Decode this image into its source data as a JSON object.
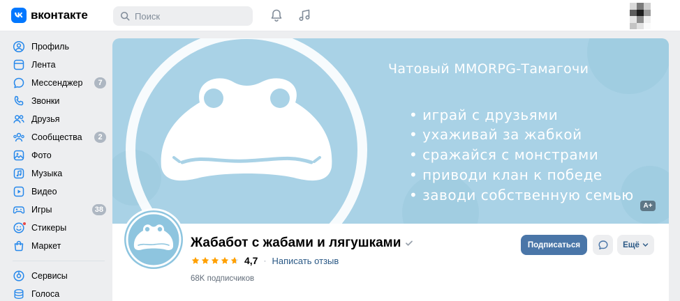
{
  "header": {
    "logo_text": "вконтакте",
    "logo_mark": "vk",
    "search_placeholder": "Поиск",
    "icons": [
      "bell-icon",
      "music-icon"
    ]
  },
  "sidebar": {
    "items": [
      {
        "label": "Профиль",
        "icon": "profile-icon"
      },
      {
        "label": "Лента",
        "icon": "feed-icon"
      },
      {
        "label": "Мессенджер",
        "icon": "messenger-icon",
        "badge": "7"
      },
      {
        "label": "Звонки",
        "icon": "phone-icon"
      },
      {
        "label": "Друзья",
        "icon": "friends-icon"
      },
      {
        "label": "Сообщества",
        "icon": "communities-icon",
        "badge": "2"
      },
      {
        "label": "Фото",
        "icon": "photo-icon"
      },
      {
        "label": "Музыка",
        "icon": "music-icon"
      },
      {
        "label": "Видео",
        "icon": "video-icon"
      },
      {
        "label": "Игры",
        "icon": "games-icon",
        "badge": "38"
      },
      {
        "label": "Стикеры",
        "icon": "stickers-icon"
      },
      {
        "label": "Маркет",
        "icon": "market-icon"
      }
    ],
    "secondary": [
      {
        "label": "Сервисы",
        "icon": "services-icon"
      },
      {
        "label": "Голоса",
        "icon": "votes-icon"
      }
    ]
  },
  "cover": {
    "title": "Чатовый MMORPG-Тамагочи",
    "bullets": [
      "• играй с друзьями",
      "• ухаживай за жабкой",
      "• сражайся с монстрами",
      "• приводи клан к победе",
      "• заводи собственную семью"
    ],
    "badge": "A+",
    "colors": {
      "bg": "#a9d2e6",
      "text": "#ffffff"
    }
  },
  "community": {
    "title": "Жабабот с жабами и лягушками",
    "verified_icon": "check-icon",
    "rating": "4,7",
    "rating_stars": 4.7,
    "review_link": "Написать отзыв",
    "subscribers": "68K подписчиков"
  },
  "actions": {
    "subscribe": "Подписаться",
    "more": "Ещё"
  },
  "colors": {
    "accent": "#0077ff",
    "button": "#4a76a8",
    "link": "#2a5885",
    "badge": "#aeb7c2"
  }
}
